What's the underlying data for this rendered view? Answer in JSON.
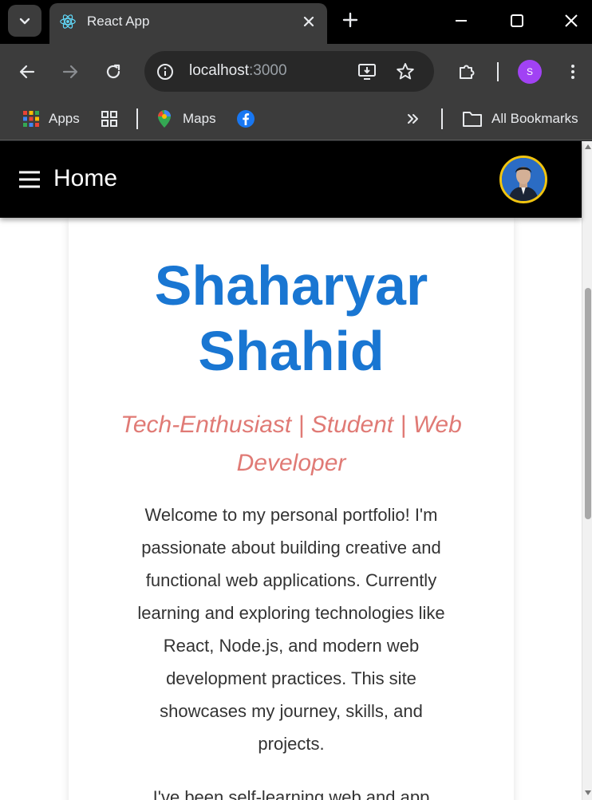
{
  "browser": {
    "tab_title": "React App",
    "url_host": "localhost",
    "url_port": ":3000",
    "profile_initial": "S",
    "bookmarks": {
      "apps_label": "Apps",
      "maps_label": "Maps",
      "all_bookmarks_label": "All Bookmarks"
    }
  },
  "appbar": {
    "title": "Home"
  },
  "hero": {
    "name_line1": "Shaharyar",
    "name_line2": "Shahid",
    "tagline_line1": "Tech-Enthusiast | Student | Web",
    "tagline_line2": "Developer",
    "intro_lines": [
      "Welcome to my personal portfolio! I'm",
      "passionate about building creative and",
      "functional web applications. Currently",
      "learning and exploring technologies like",
      "React, Node.js, and modern web",
      "development practices. This site",
      "showcases my journey, skills, and",
      "projects."
    ],
    "intro2_partial": "I've been self-learning web and app"
  },
  "colors": {
    "accent_blue": "#1976d2",
    "tagline_color": "#e07a75",
    "avatar_ring": "#f1c40f"
  }
}
